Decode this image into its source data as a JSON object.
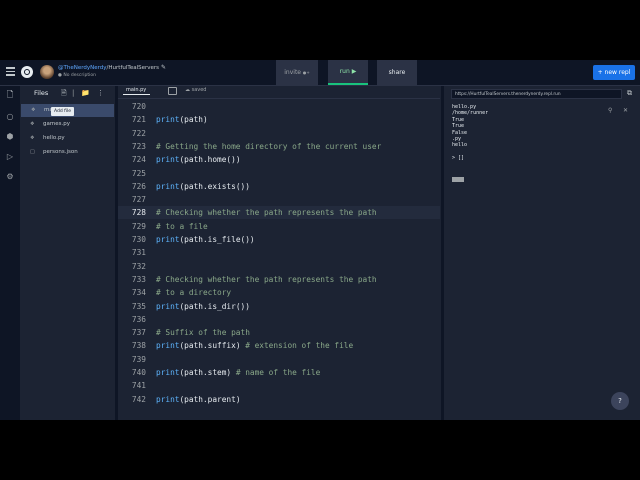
{
  "header": {
    "owner": "@TheNerdyNerdy",
    "repl_name": "HurtfulTealServers",
    "description": "No description",
    "invite_label": "invite",
    "run_label": "run",
    "share_label": "share",
    "new_repl_label": "+ new repl"
  },
  "files_panel": {
    "title": "Files",
    "tooltip": "Add file",
    "items": [
      {
        "label": "ma..."
      },
      {
        "label": "games.py"
      },
      {
        "label": "hello.py"
      },
      {
        "label": "persons.json"
      }
    ]
  },
  "editor": {
    "tab": "main.py",
    "status": "saved",
    "lines": [
      {
        "n": "720",
        "segments": []
      },
      {
        "n": "721",
        "segments": [
          {
            "t": "print",
            "c": "fn"
          },
          {
            "t": "(path)",
            "c": ""
          }
        ]
      },
      {
        "n": "722",
        "segments": []
      },
      {
        "n": "723",
        "segments": [
          {
            "t": "# Getting the home directory of the current user",
            "c": "cm"
          }
        ]
      },
      {
        "n": "724",
        "segments": [
          {
            "t": "print",
            "c": "fn"
          },
          {
            "t": "(path.home())",
            "c": ""
          }
        ]
      },
      {
        "n": "725",
        "segments": []
      },
      {
        "n": "726",
        "segments": [
          {
            "t": "print",
            "c": "fn"
          },
          {
            "t": "(path.exists())",
            "c": ""
          }
        ]
      },
      {
        "n": "727",
        "segments": []
      },
      {
        "n": "728",
        "segments": [
          {
            "t": "# Checking whether the path represents the path",
            "c": "cm"
          }
        ]
      },
      {
        "n": "729",
        "segments": [
          {
            "t": "# to a file",
            "c": "cm"
          }
        ]
      },
      {
        "n": "730",
        "segments": [
          {
            "t": "print",
            "c": "fn"
          },
          {
            "t": "(path.is_file())",
            "c": ""
          }
        ]
      },
      {
        "n": "731",
        "segments": []
      },
      {
        "n": "732",
        "segments": []
      },
      {
        "n": "733",
        "segments": [
          {
            "t": "# Checking whether the path represents the path",
            "c": "cm"
          }
        ]
      },
      {
        "n": "734",
        "segments": [
          {
            "t": "# to a directory",
            "c": "cm"
          }
        ]
      },
      {
        "n": "735",
        "segments": [
          {
            "t": "print",
            "c": "fn"
          },
          {
            "t": "(path.is_dir())",
            "c": ""
          }
        ]
      },
      {
        "n": "736",
        "segments": []
      },
      {
        "n": "737",
        "segments": [
          {
            "t": "# Suffix of the path",
            "c": "cm"
          }
        ]
      },
      {
        "n": "738",
        "segments": [
          {
            "t": "print",
            "c": "fn"
          },
          {
            "t": "(path.suffix) ",
            "c": ""
          },
          {
            "t": "# extension of the file",
            "c": "cm"
          }
        ]
      },
      {
        "n": "739",
        "segments": []
      },
      {
        "n": "740",
        "segments": [
          {
            "t": "print",
            "c": "fn"
          },
          {
            "t": "(path.stem) ",
            "c": ""
          },
          {
            "t": "# name of the file",
            "c": "cm"
          }
        ]
      },
      {
        "n": "741",
        "segments": []
      },
      {
        "n": "742",
        "segments": [
          {
            "t": "print",
            "c": "fn"
          },
          {
            "t": "(path.parent)",
            "c": ""
          }
        ]
      }
    ],
    "active_line": "728"
  },
  "console": {
    "url": "https://HurtfulTealServers.thenerdynerdy.repl.run",
    "output": [
      "hello.py",
      "/home/runner",
      "True",
      "True",
      "False",
      ".py",
      "hello",
      "",
      "> []"
    ]
  },
  "help_label": "?"
}
